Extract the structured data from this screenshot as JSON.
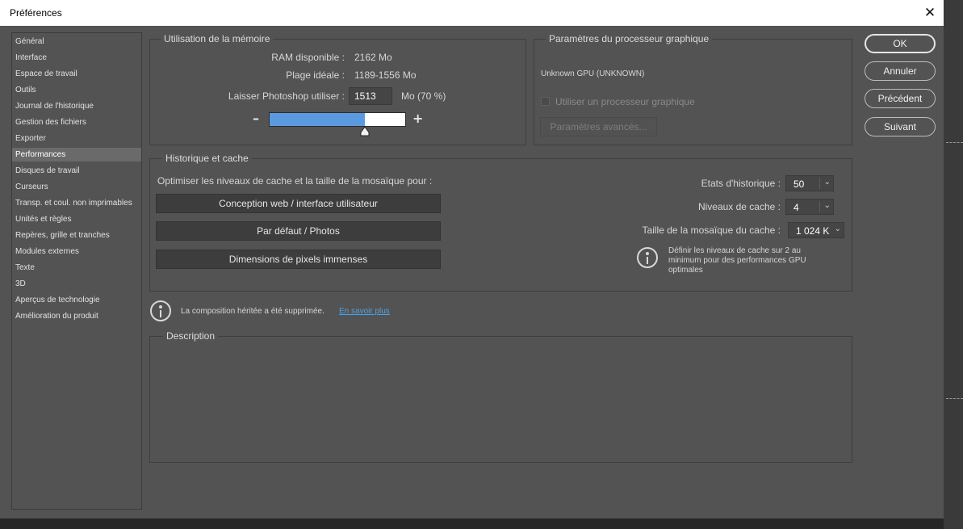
{
  "window": {
    "title": "Préférences",
    "close_glyph": "✕"
  },
  "sidebar": {
    "items": [
      {
        "label": "Général"
      },
      {
        "label": "Interface"
      },
      {
        "label": "Espace de travail"
      },
      {
        "label": "Outils"
      },
      {
        "label": "Journal de l'historique"
      },
      {
        "label": "Gestion des fichiers"
      },
      {
        "label": "Exporter"
      },
      {
        "label": "Performances",
        "selected": true
      },
      {
        "label": "Disques de travail"
      },
      {
        "label": "Curseurs"
      },
      {
        "label": "Transp. et coul. non imprimables"
      },
      {
        "label": "Unités et règles"
      },
      {
        "label": "Repères, grille et tranches"
      },
      {
        "label": "Modules externes"
      },
      {
        "label": "Texte"
      },
      {
        "label": "3D"
      },
      {
        "label": "Aperçus de technologie"
      },
      {
        "label": "Amélioration du produit"
      }
    ]
  },
  "memory": {
    "title": "Utilisation de la mémoire",
    "ram_label": "RAM disponible :",
    "ram_value": "2162 Mo",
    "ideal_label": "Plage idéale :",
    "ideal_value": "1189-1556 Mo",
    "use_label": "Laisser Photoshop utiliser :",
    "use_value": "1513",
    "use_suffix": "Mo (70 %)",
    "minus": "–",
    "plus": "+",
    "slider_fraction": 0.7
  },
  "gpu": {
    "title": "Paramètres du processeur graphique",
    "gpu_name": "Unknown GPU (UNKNOWN)",
    "use_gpu_label": "Utiliser un processeur graphique",
    "advanced_button": "Paramètres avancés..."
  },
  "cache": {
    "title": "Historique et cache",
    "optimize_label": "Optimiser les niveaux de cache et la taille de la mosaïque pour :",
    "buttons": [
      "Conception web / interface utilisateur",
      "Par défaut / Photos",
      "Dimensions de pixels immenses"
    ],
    "history_label": "Etats d'historique :",
    "history_value": "50",
    "levels_label": "Niveaux de cache :",
    "levels_value": "4",
    "tile_label": "Taille de la mosaïque du cache :",
    "tile_value": "1 024 K",
    "hint": [
      "Définir les niveaux de cache sur 2 au",
      "minimum pour des performances GPU",
      "optimales"
    ]
  },
  "notice": {
    "text": "La composition héritée a été supprimée.",
    "link": "En savoir plus"
  },
  "description": {
    "title": "Description",
    "text": ""
  },
  "buttons": {
    "ok": "OK",
    "cancel": "Annuler",
    "previous": "Précédent",
    "next": "Suivant"
  }
}
